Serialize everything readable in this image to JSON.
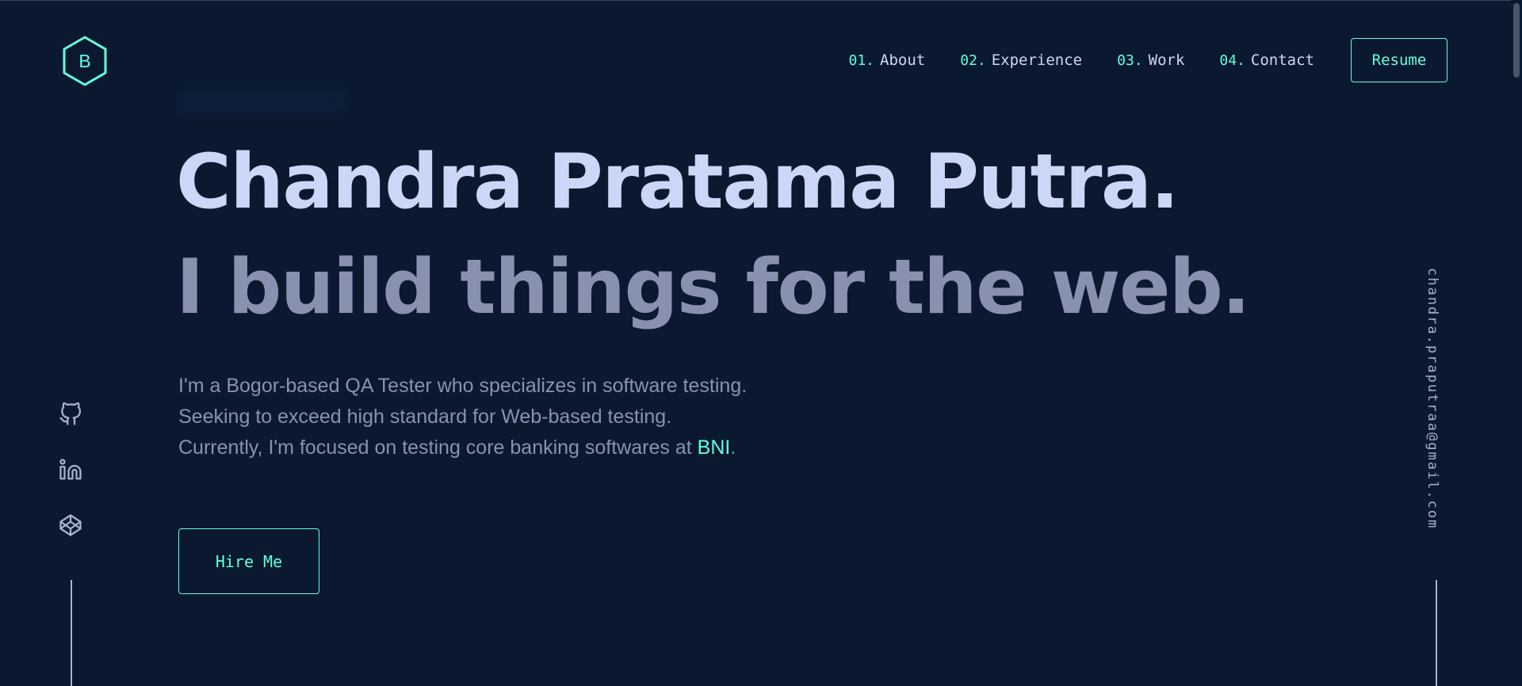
{
  "logo": {
    "letter": "B",
    "icon": "hexagon-logo-icon"
  },
  "nav": {
    "items": [
      {
        "num": "01.",
        "label": "About"
      },
      {
        "num": "02.",
        "label": "Experience"
      },
      {
        "num": "03.",
        "label": "Work"
      },
      {
        "num": "04.",
        "label": "Contact"
      }
    ],
    "resume_label": "Resume"
  },
  "hero": {
    "name": "Chandra Pratama Putra.",
    "tagline": "I build things for the web.",
    "desc_line1": "I'm a Bogor-based QA Tester who specializes in software testing.",
    "desc_line2": "Seeking to exceed high standard for Web-based testing.",
    "desc_line3_prefix": "Currently, I'm focused on testing core banking softwares at ",
    "desc_line3_link": "BNI",
    "desc_line3_suffix": ".",
    "hire_label": "Hire Me"
  },
  "social": {
    "icons": [
      "github-icon",
      "linkedin-icon",
      "codepen-icon"
    ]
  },
  "email": "chandra.praputraa@gmail.com",
  "colors": {
    "background": "#0a192f",
    "accent": "#64ffda",
    "lightest_slate": "#ccd6f6",
    "slate": "#8892b0",
    "light_slate": "#a8b2d1"
  }
}
